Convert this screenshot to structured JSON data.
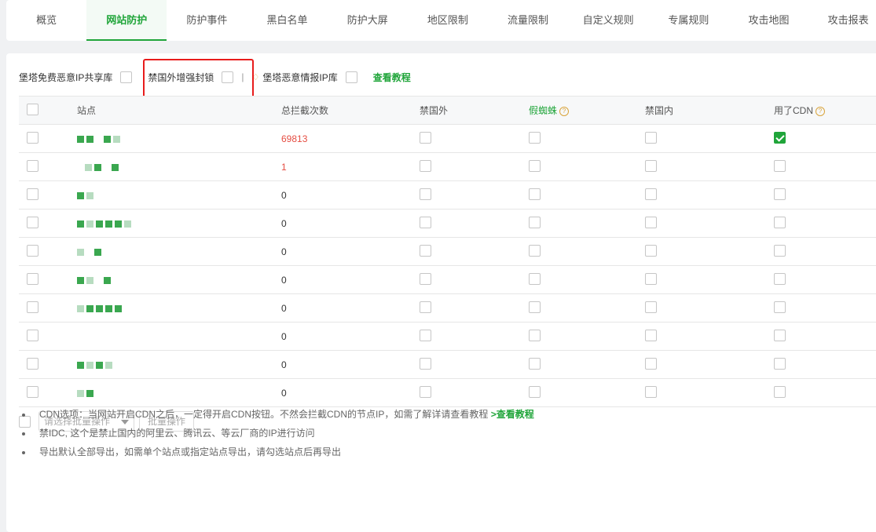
{
  "tabs": [
    "概览",
    "网站防护",
    "防护事件",
    "黑白名单",
    "防护大屏",
    "地区限制",
    "流量限制",
    "自定义规则",
    "专属规则",
    "攻击地图",
    "攻击报表"
  ],
  "active_tab": "网站防护",
  "options": {
    "free_ip_lib": "堡塔免费恶意IP共享库",
    "foreign_block": "禁国外增强封锁",
    "intel_lib": "堡塔恶意情报IP库",
    "tutorial": "查看教程"
  },
  "table": {
    "headers": [
      "站点",
      "总拦截次数",
      "禁国外",
      "假蜘蛛",
      "禁国内",
      "用了CDN"
    ],
    "rows": [
      {
        "count": "69813",
        "cdn": true
      },
      {
        "count": "1",
        "cdn": false
      },
      {
        "count": "0",
        "cdn": false
      },
      {
        "count": "0",
        "cdn": false
      },
      {
        "count": "0",
        "cdn": false
      },
      {
        "count": "0",
        "cdn": false
      },
      {
        "count": "0",
        "cdn": false
      },
      {
        "count": "0",
        "cdn": false
      },
      {
        "count": "0",
        "cdn": false
      },
      {
        "count": "0",
        "cdn": false
      }
    ]
  },
  "batch": {
    "placeholder": "请选择批量操作",
    "button": "批量操作"
  },
  "notes": {
    "n1": "CDN选项：当网站开启CDN之后，一定得开启CDN按钮。不然会拦截CDN的节点IP，如需了解详请查看教程",
    "n1_link": ">查看教程",
    "n2": "禁IDC, 这个是禁止国内的阿里云、腾讯云、等云厂商的IP进行访问",
    "n3": "导出默认全部导出，如需单个站点或指定站点导出，请勾选站点后再导出"
  }
}
